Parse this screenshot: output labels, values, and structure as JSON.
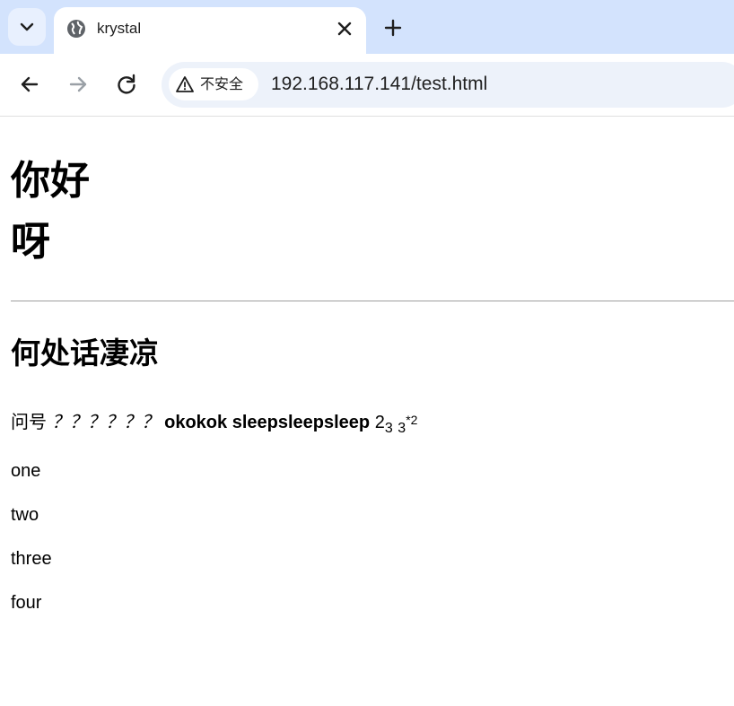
{
  "browser": {
    "tab_title": "krystal",
    "security_label": "不安全",
    "url": "192.168.117.141/test.html"
  },
  "page": {
    "heading_lines": [
      "你好",
      "呀"
    ],
    "subheading": "何处话凄凉",
    "paragraph": {
      "prefix": "问号",
      "italic": "？？？？？？",
      "bold": "okokok sleepsleepsleep",
      "base": "2",
      "sub1": "3",
      "mid": "3",
      "sup_star": "*",
      "sup": "2"
    },
    "lines": [
      "one",
      "two",
      "three",
      "four"
    ]
  },
  "icons": {
    "tab_search": "chevron-down-icon",
    "favicon": "globe-icon",
    "close": "close-icon",
    "new_tab": "plus-icon",
    "back": "arrow-left-icon",
    "forward": "arrow-right-icon",
    "reload": "reload-icon",
    "security": "warning-triangle-icon"
  }
}
